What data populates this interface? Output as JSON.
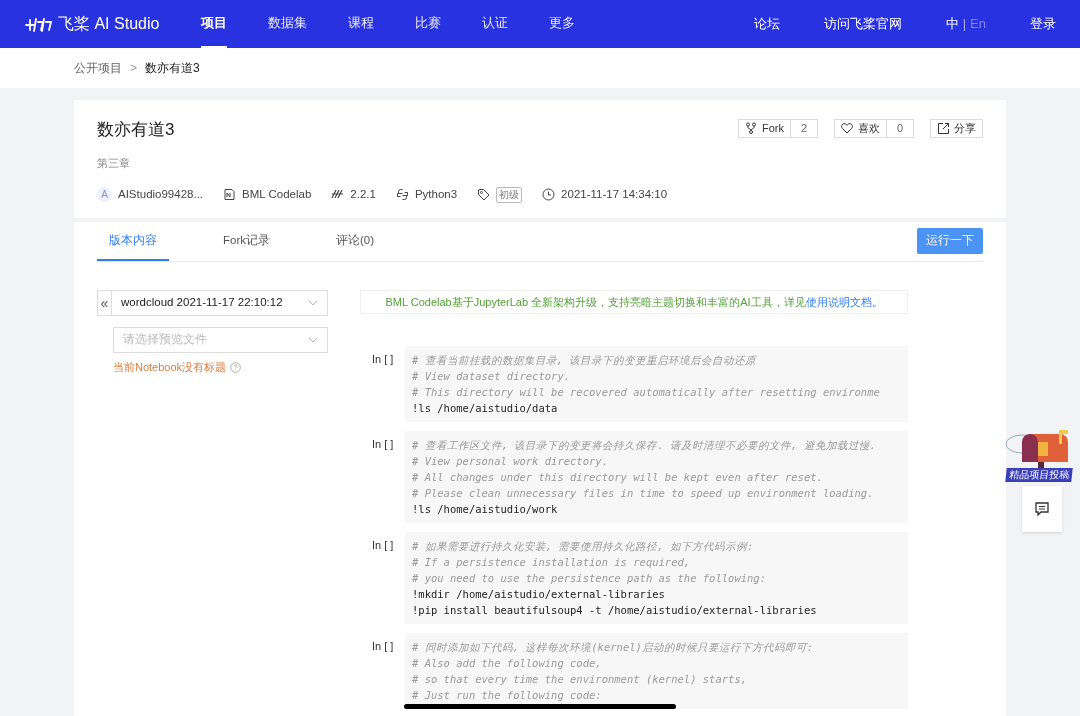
{
  "nav": {
    "logo": "飞桨 AI Studio",
    "items": [
      {
        "label": "项目",
        "selected": true
      },
      {
        "label": "数据集",
        "selected": false
      },
      {
        "label": "课程",
        "selected": false
      },
      {
        "label": "比赛",
        "selected": false
      },
      {
        "label": "认证",
        "selected": false
      },
      {
        "label": "更多",
        "selected": false
      }
    ],
    "right_links": [
      "论坛",
      "访问飞桨官网"
    ],
    "languages": [
      {
        "label": "中",
        "selected": true
      },
      {
        "label": "En",
        "selected": false
      }
    ],
    "lang_separator": "|",
    "login": "登录"
  },
  "breadcrumb": {
    "items": [
      "公开项目",
      "数亦有道3"
    ],
    "separator": ">"
  },
  "project": {
    "title": "数亦有道3",
    "subtitle": "第三章",
    "actions": [
      {
        "kind": "fork",
        "label": "Fork",
        "count": "2"
      },
      {
        "kind": "like",
        "label": "喜欢",
        "count": "0"
      },
      {
        "kind": "share",
        "label": "分享"
      }
    ],
    "meta": [
      {
        "kind": "author",
        "avatar": "A",
        "text": "AIStudio99428..."
      },
      {
        "kind": "env",
        "text": "BML Codelab"
      },
      {
        "kind": "version",
        "text": "2.2.1"
      },
      {
        "kind": "language",
        "text": "Python3"
      },
      {
        "kind": "level",
        "text": "初级"
      },
      {
        "kind": "time",
        "text": "2021-11-17 14:34:10"
      }
    ]
  },
  "tabs": [
    {
      "label": "版本内容",
      "selected": true
    },
    {
      "label": "Fork记录",
      "selected": false
    },
    {
      "label": "评论(0)",
      "selected": false
    }
  ],
  "run_button": "运行一下",
  "sidebar": {
    "collapse": "«",
    "version_select": {
      "value": "wordcloud 2021-11-17 22:10:12"
    },
    "file_select": {
      "placeholder": "请选择预览文件"
    },
    "notice": "当前Notebook没有标题"
  },
  "banner": {
    "text": "BML Codelab基于JupyterLab 全新架构升级，支持亮暗主题切换和丰富的AI工具，详见",
    "link": "使用说明文档",
    "end": "。"
  },
  "cells": [
    {
      "prompt": "In [ ]",
      "lines": [
        {
          "kind": "comment",
          "text": "# 查看当前挂载的数据集目录, 该目录下的变更重启环境后会自动还原"
        },
        {
          "kind": "comment",
          "text": "# View dataset directory."
        },
        {
          "kind": "comment",
          "text": "# This directory will be recovered automatically after resetting environme"
        },
        {
          "kind": "code",
          "text": "!ls /home/aistudio/data"
        }
      ]
    },
    {
      "prompt": "In [ ]",
      "lines": [
        {
          "kind": "comment",
          "text": "# 查看工作区文件, 该目录下的变更将会持久保存. 请及时清理不必要的文件, 避免加载过慢."
        },
        {
          "kind": "comment",
          "text": "# View personal work directory."
        },
        {
          "kind": "comment",
          "text": "# All changes under this directory will be kept even after reset."
        },
        {
          "kind": "comment",
          "text": "# Please clean unnecessary files in time to speed up environment loading."
        },
        {
          "kind": "code",
          "text": "!ls /home/aistudio/work"
        }
      ]
    },
    {
      "prompt": "In [ ]",
      "lines": [
        {
          "kind": "comment",
          "text": "# 如果需要进行持久化安装, 需要使用持久化路径, 如下方代码示例:"
        },
        {
          "kind": "comment",
          "text": "# If a persistence installation is required,"
        },
        {
          "kind": "comment",
          "text": "# you need to use the persistence path as the following:"
        },
        {
          "kind": "code",
          "text": "!mkdir /home/aistudio/external-libraries"
        },
        {
          "kind": "code",
          "text": "!pip install beautifulsoup4 -t /home/aistudio/external-libraries"
        }
      ]
    },
    {
      "prompt": "In [ ]",
      "lines": [
        {
          "kind": "comment",
          "text": "# 同时添加如下代码, 这样每次环境(kernel)启动的时候只要运行下方代码即可:"
        },
        {
          "kind": "comment",
          "text": "# Also add the following code,"
        },
        {
          "kind": "comment",
          "text": "# so that every time the environment (kernel) starts,"
        },
        {
          "kind": "comment",
          "text": "# Just run the following code:"
        }
      ]
    }
  ],
  "float": {
    "promo_label": "精品项目投稿"
  }
}
